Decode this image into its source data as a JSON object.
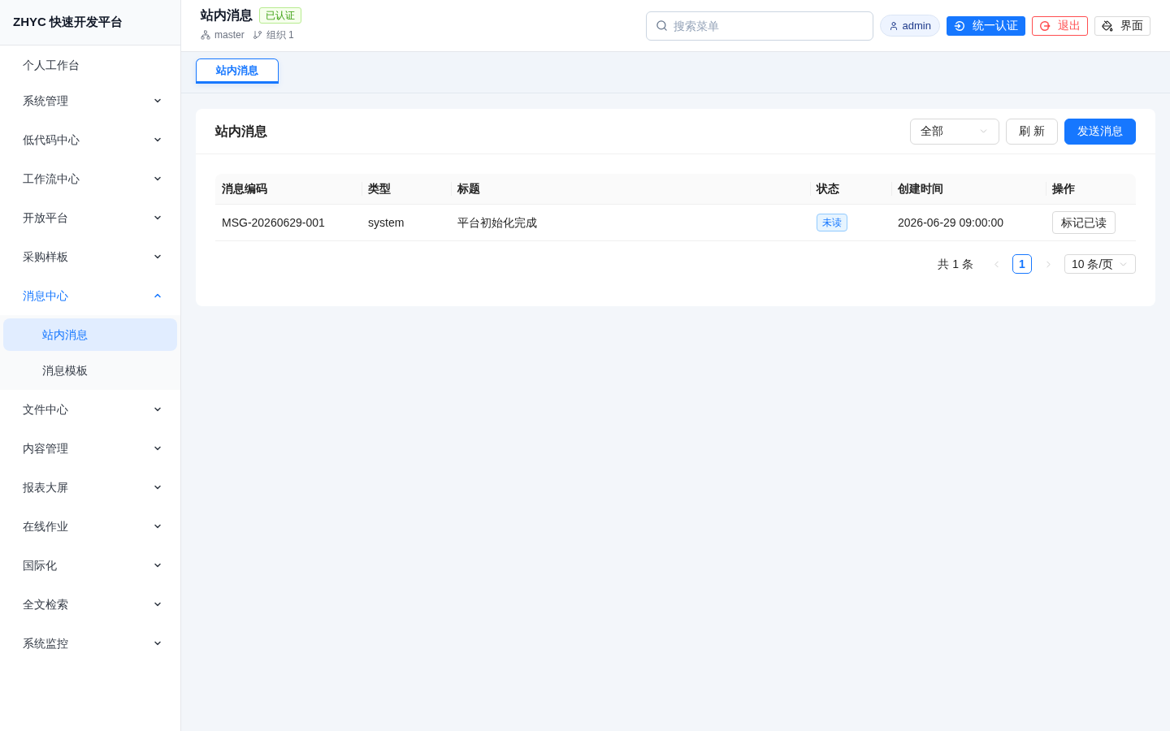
{
  "sidebar": {
    "logo": "ZHYC 快速开发平台",
    "items": [
      {
        "label": "个人工作台",
        "kind": "link",
        "selected": false
      },
      {
        "label": "系统管理",
        "kind": "group",
        "selected": false,
        "expanded": false
      },
      {
        "label": "低代码中心",
        "kind": "group",
        "selected": false,
        "expanded": false
      },
      {
        "label": "工作流中心",
        "kind": "group",
        "selected": false,
        "expanded": false
      },
      {
        "label": "开放平台",
        "kind": "group",
        "selected": false,
        "expanded": false
      },
      {
        "label": "采购样板",
        "kind": "group",
        "selected": false,
        "expanded": false
      },
      {
        "label": "消息中心",
        "kind": "group",
        "selected": false,
        "expanded": true,
        "children": [
          {
            "label": "站内消息",
            "selected": true
          },
          {
            "label": "消息模板",
            "selected": false
          }
        ]
      },
      {
        "label": "文件中心",
        "kind": "group",
        "selected": false,
        "expanded": false
      },
      {
        "label": "内容管理",
        "kind": "group",
        "selected": false,
        "expanded": false
      },
      {
        "label": "报表大屏",
        "kind": "group",
        "selected": false,
        "expanded": false
      },
      {
        "label": "在线作业",
        "kind": "group",
        "selected": false,
        "expanded": false
      },
      {
        "label": "国际化",
        "kind": "group",
        "selected": false,
        "expanded": false
      },
      {
        "label": "全文检索",
        "kind": "group",
        "selected": false,
        "expanded": false
      },
      {
        "label": "系统监控",
        "kind": "group",
        "selected": false,
        "expanded": false
      }
    ]
  },
  "header": {
    "title": "站内消息",
    "badge": "已认证",
    "meta": [
      {
        "kind": "tree",
        "text": "master"
      },
      {
        "kind": "branch",
        "text": "组织 1"
      }
    ],
    "search": {
      "placeholder": "搜索菜单"
    },
    "user": "admin",
    "buttons": [
      {
        "kind": "primary",
        "label": "统一认证"
      },
      {
        "kind": "danger",
        "label": "退出"
      },
      {
        "kind": "default",
        "label": "界面"
      }
    ]
  },
  "tabs": [
    {
      "label": "站内消息",
      "selected": true
    }
  ],
  "card": {
    "title": "站内消息",
    "filter": {
      "value": "全部"
    },
    "buttons": [
      {
        "kind": "default",
        "label": "刷 新"
      },
      {
        "kind": "primary",
        "label": "发送消息"
      }
    ]
  },
  "table": {
    "columns": [
      "消息编码",
      "类型",
      "标题",
      "状态",
      "创建时间",
      "操作"
    ],
    "rows": [
      {
        "code": "MSG-20260629-001",
        "type": "system",
        "title": "平台初始化完成",
        "status": "未读",
        "created": "2026-06-29 09:00:00",
        "action": "标记已读"
      }
    ]
  },
  "pagination": {
    "total": "共 1 条",
    "prev": {
      "disabled": true
    },
    "pages": [
      {
        "label": "1",
        "selected": true
      }
    ],
    "next": {
      "disabled": true
    },
    "page_size": "10 条/页"
  }
}
